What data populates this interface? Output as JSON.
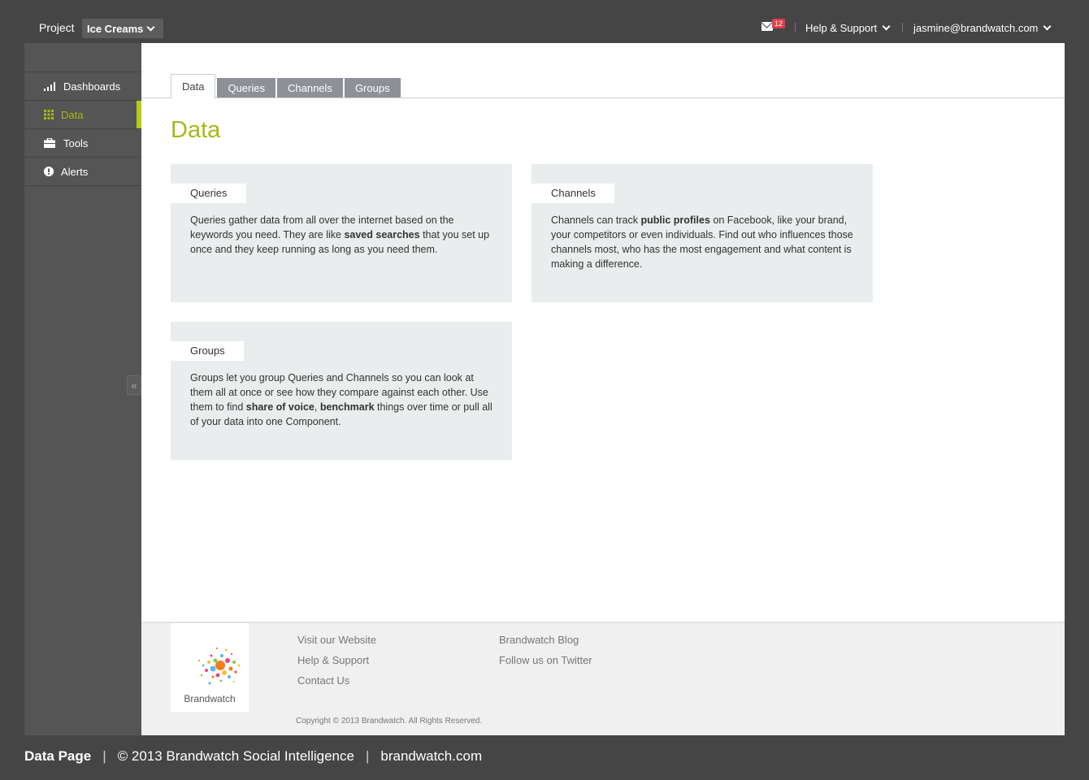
{
  "topbar": {
    "project_label": "Project",
    "project_value": "Ice Creams",
    "mail_count": "12",
    "help_label": "Help & Support",
    "user_email": "jasmine@brandwatch.com"
  },
  "sidebar": {
    "items": [
      {
        "label": "Dashboards",
        "icon": "bar-chart-icon"
      },
      {
        "label": "Data",
        "icon": "grid-icon",
        "active": true
      },
      {
        "label": "Tools",
        "icon": "toolbox-icon"
      },
      {
        "label": "Alerts",
        "icon": "alert-icon"
      }
    ],
    "collapse_glyph": "«"
  },
  "tabs": [
    {
      "label": "Data",
      "active": true
    },
    {
      "label": "Queries"
    },
    {
      "label": "Channels"
    },
    {
      "label": "Groups"
    }
  ],
  "page_title": "Data",
  "cards": {
    "queries": {
      "title": "Queries",
      "p1": "Queries gather data from all over the internet based on the keywords you need. They are like ",
      "b1": "saved searches",
      "p2": " that you set up once and they keep running as long as you need them."
    },
    "channels": {
      "title": "Channels",
      "p1": "Channels can track ",
      "b1": "public profiles",
      "p2": " on Facebook, like your brand, your competitors or even individuals. Find out who influences those channels most, who has the most engagement and what content is making a difference."
    },
    "groups": {
      "title": "Groups",
      "p1": "Groups let you group Queries and Channels so you can look at them all at once or see how they compare against each other. Use them to find ",
      "b1": "share of voice",
      "p2": ", ",
      "b2": "benchmark",
      "p3": " things over time or pull all of your data into one Component."
    }
  },
  "footer": {
    "logo_text": "Brandwatch",
    "col1": [
      "Visit our Website",
      "Help & Support",
      "Contact Us"
    ],
    "col2": [
      "Brandwatch Blog",
      "Follow us on Twitter"
    ],
    "copyright": "Copyright © 2013 Brandwatch. All Rights Reserved."
  },
  "caption": {
    "page": "Data Page",
    "sep": "|",
    "copyright": "© 2013 Brandwatch Social Intelligence",
    "site": "brandwatch.com"
  },
  "colors": {
    "accent": "#a6b919",
    "badge": "#e23d4b",
    "background": "#454545",
    "sidebar": "#555555",
    "tab": "#8d9096",
    "card": "#eaeded"
  }
}
